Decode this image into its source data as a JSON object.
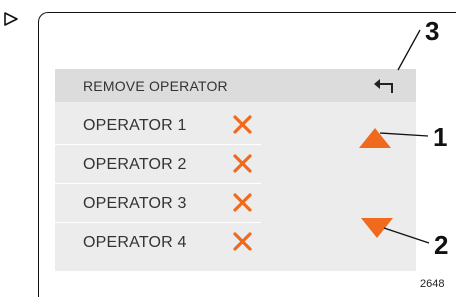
{
  "screen": {
    "title": "REMOVE OPERATOR",
    "operators": [
      {
        "label": "OPERATOR 1"
      },
      {
        "label": "OPERATOR 2"
      },
      {
        "label": "OPERATOR 3"
      },
      {
        "label": "OPERATOR 4"
      }
    ],
    "icons": {
      "back": "back-arrow-icon",
      "remove": "remove-x-icon",
      "scroll_up": "arrow-up-icon",
      "scroll_down": "arrow-down-icon"
    }
  },
  "callouts": {
    "one": "1",
    "two": "2",
    "three": "3"
  },
  "figure_id": "2648",
  "colors": {
    "accent": "#f06a1e",
    "title_bar": "#dcdcdc",
    "screen_bg": "#ececec",
    "text": "#333333"
  }
}
